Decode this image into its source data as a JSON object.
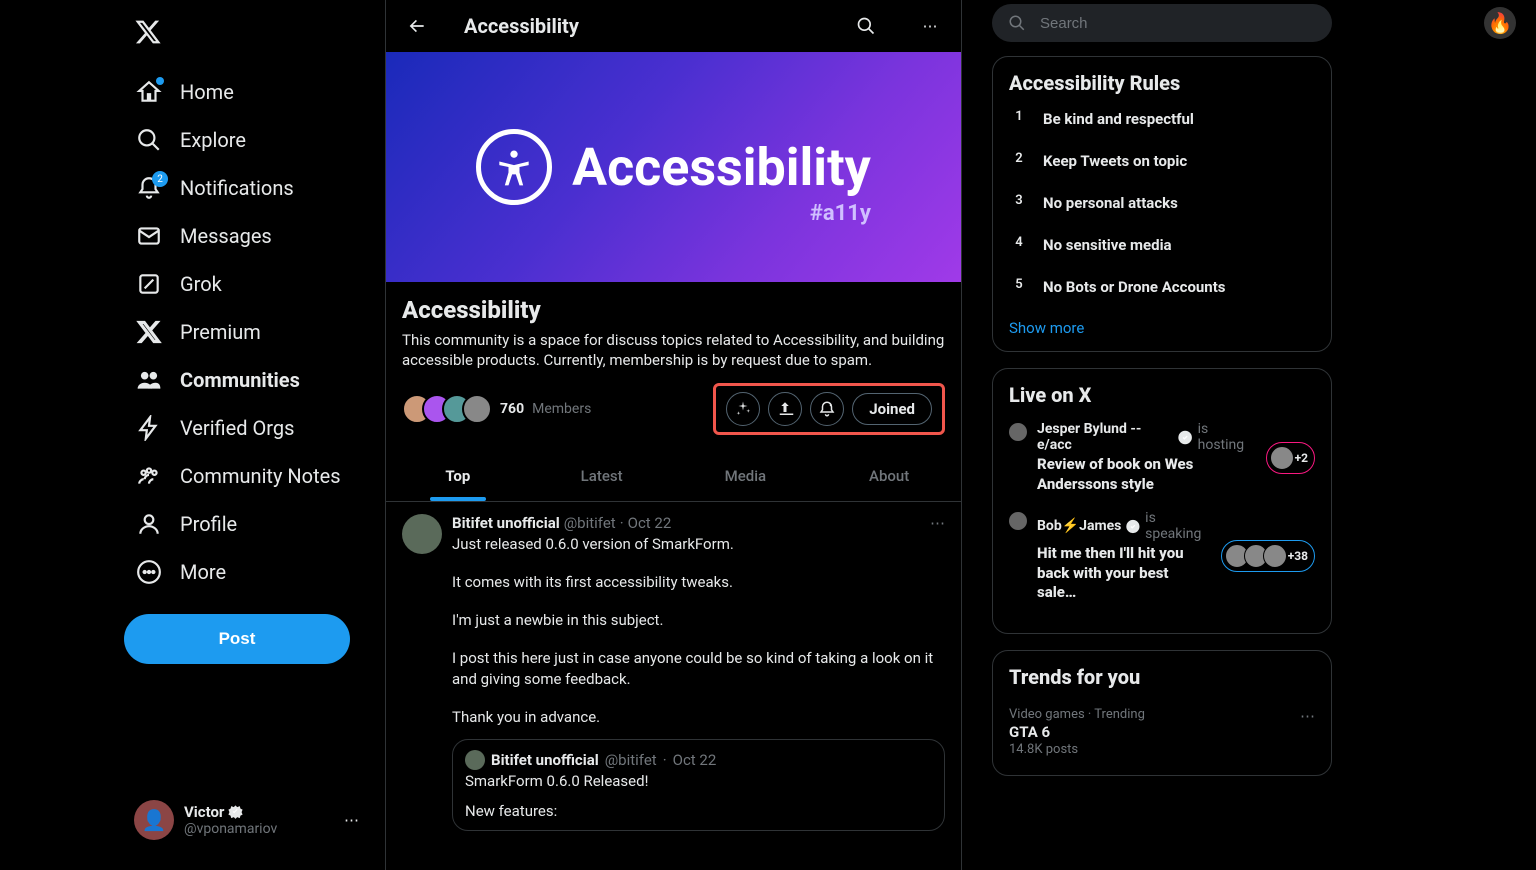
{
  "nav": {
    "items": [
      {
        "label": "Home",
        "dot": true
      },
      {
        "label": "Explore"
      },
      {
        "label": "Notifications",
        "badge": "2"
      },
      {
        "label": "Messages"
      },
      {
        "label": "Grok"
      },
      {
        "label": "Premium"
      },
      {
        "label": "Communities",
        "active": true
      },
      {
        "label": "Verified Orgs"
      },
      {
        "label": "Community Notes"
      },
      {
        "label": "Profile"
      },
      {
        "label": "More"
      }
    ],
    "post": "Post"
  },
  "account": {
    "name": "Victor",
    "handle": "@vponamariov",
    "avatar_emoji": "👤"
  },
  "header": {
    "title": "Accessibility"
  },
  "banner": {
    "title": "Accessibility",
    "hashtag": "#a11y"
  },
  "community": {
    "name": "Accessibility",
    "description": "This community is a space for discuss topics related to Accessibility, and building accessible products. Currently, membership is by request due to spam.",
    "member_count": "760",
    "member_label": "Members",
    "joined": "Joined"
  },
  "tabs": [
    "Top",
    "Latest",
    "Media",
    "About"
  ],
  "post": {
    "author": "Bitifet unofficial",
    "handle": "@bitifet",
    "date": "Oct 22",
    "p1": "Just released 0.6.0 version of SmarkForm.",
    "p2": "It comes with its first accessibility tweaks.",
    "p3": "I'm just a newbie in this subject.",
    "p4": "I post this here just in case anyone could be so kind of taking a look on it and giving some feedback.",
    "p5": "Thank you in advance.",
    "quoted": {
      "author": "Bitifet unofficial",
      "handle": "@bitifet",
      "date": "Oct 22",
      "title": "SmarkForm 0.6.0 Released!",
      "l1": "New features:"
    }
  },
  "search": {
    "placeholder": "Search"
  },
  "top_avatar": "🔥",
  "rules": {
    "title": "Accessibility Rules",
    "items": [
      "Be kind and respectful",
      "Keep Tweets on topic",
      "No personal attacks",
      "No sensitive media",
      "No Bots or Drone Accounts"
    ],
    "show_more": "Show more"
  },
  "live": {
    "title": "Live on X",
    "items": [
      {
        "name": "Jesper Bylund -- e/acc",
        "status": "is hosting",
        "title": "Review of book on Wes Anderssons style",
        "extra": "+2"
      },
      {
        "name": "Bob⚡James",
        "status": "is speaking",
        "title": "Hit me then I'll hit you back with your best sale…",
        "extra": "+38"
      }
    ]
  },
  "trends": {
    "title": "Trends for you",
    "items": [
      {
        "cat": "Video games · Trending",
        "name": "GTA 6",
        "count": "14.8K posts"
      }
    ]
  }
}
